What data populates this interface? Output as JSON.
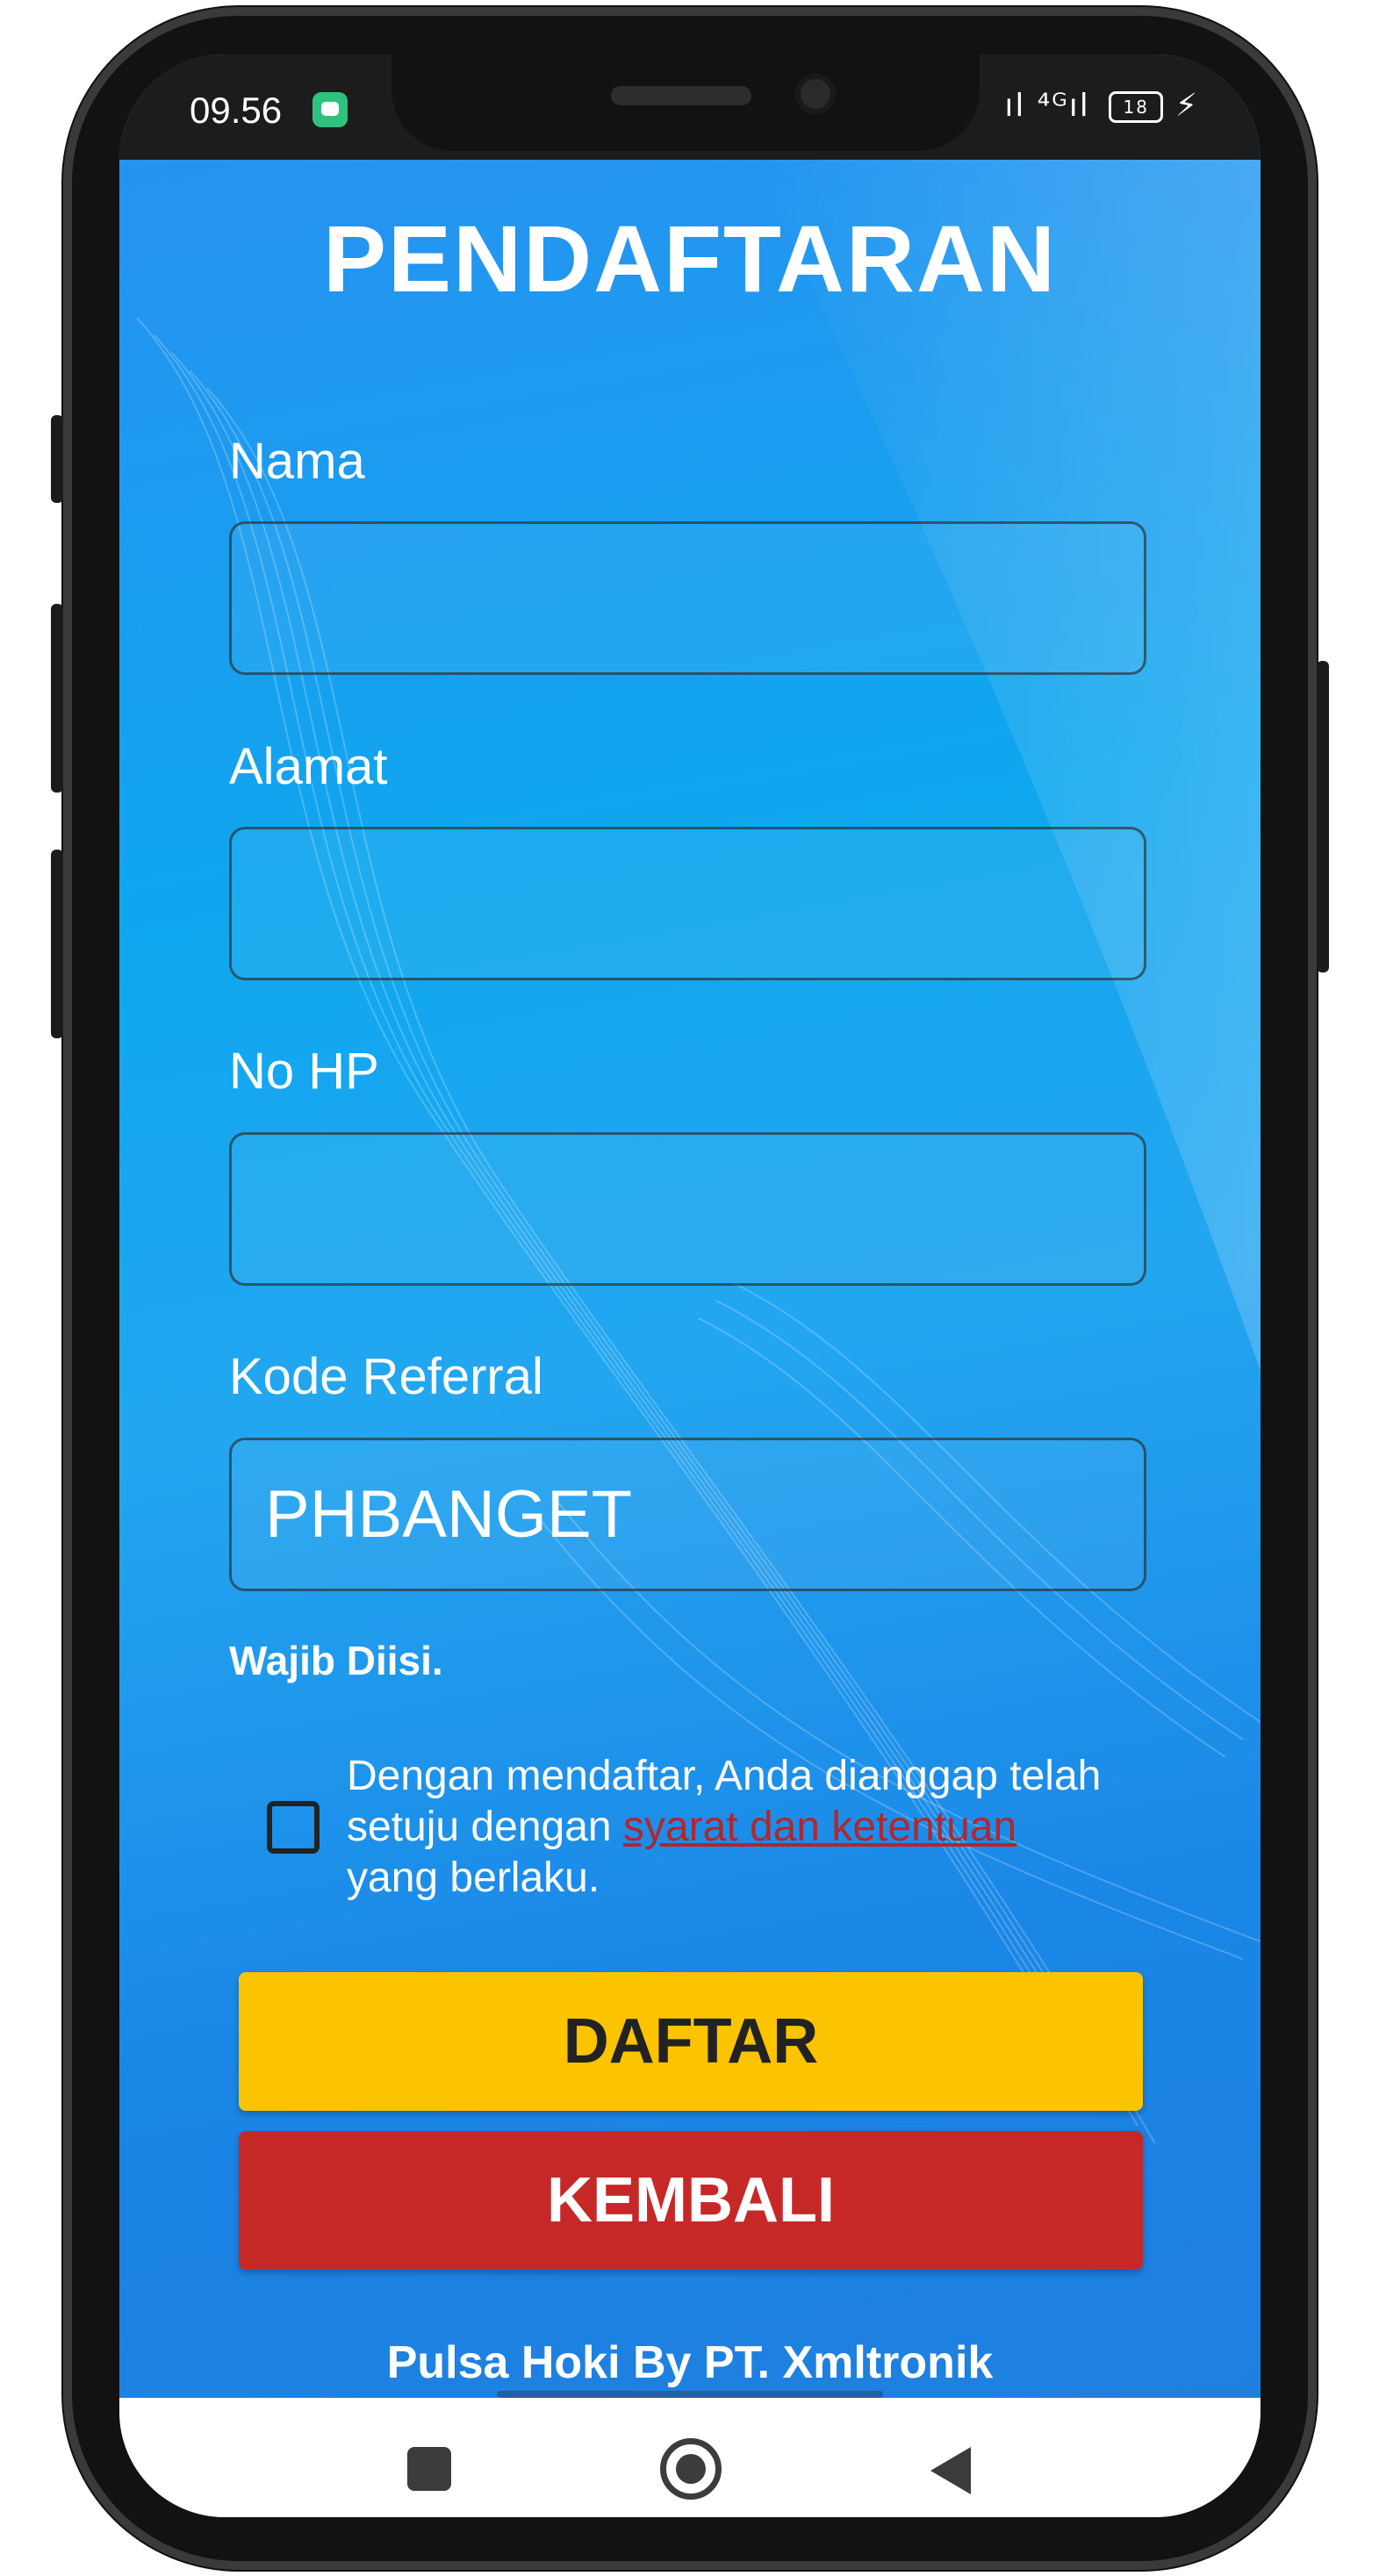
{
  "status_bar": {
    "time": "09.56",
    "signal": "ıl ⁴ᴳıl",
    "battery": "18",
    "charging": "⚡"
  },
  "page": {
    "title": "PENDAFTARAN"
  },
  "form": {
    "nama": {
      "label": "Nama",
      "value": ""
    },
    "alamat": {
      "label": "Alamat",
      "value": ""
    },
    "no_hp": {
      "label": "No HP",
      "value": ""
    },
    "kode_referral": {
      "label": "Kode Referral",
      "value": "PHBANGET"
    },
    "required_note": "Wajib Diisi.",
    "agreement": {
      "checked": false,
      "text_before": "Dengan mendaftar, Anda dianggap telah setuju dengan ",
      "link_text": "syarat dan ketentuan",
      "text_after": " yang berlaku."
    }
  },
  "buttons": {
    "daftar": "DAFTAR",
    "kembali": "KEMBALI"
  },
  "footer": {
    "text": "Pulsa Hoki By PT. Xmltronik"
  },
  "colors": {
    "daftar_button": "#fcc400",
    "kembali_button": "#c62828",
    "link": "#b3262c",
    "background": "#0fa7ef"
  },
  "nav_icons": [
    "recents-square-icon",
    "home-circle-icon",
    "back-triangle-icon"
  ]
}
